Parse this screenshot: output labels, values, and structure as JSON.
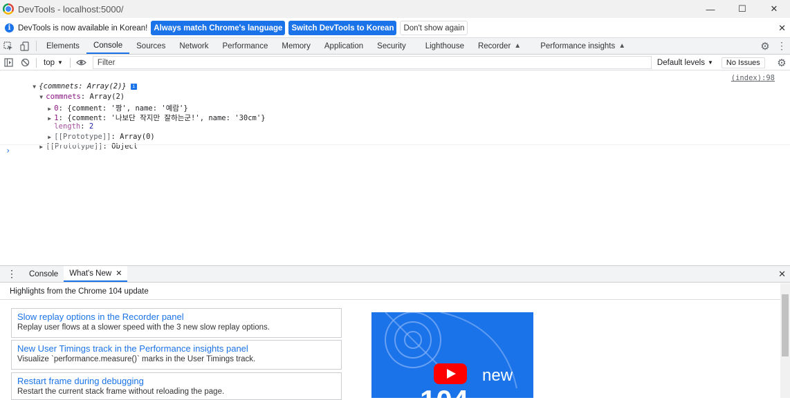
{
  "window": {
    "title": "DevTools - localhost:5000/"
  },
  "infobar": {
    "message": "DevTools is now available in Korean!",
    "btn_match": "Always match Chrome's language",
    "btn_switch": "Switch DevTools to Korean",
    "btn_dismiss": "Don't show again"
  },
  "tabs": [
    "Elements",
    "Console",
    "Sources",
    "Network",
    "Performance",
    "Memory",
    "Application",
    "Security",
    "Lighthouse",
    "Recorder",
    "Performance insights"
  ],
  "console_toolbar": {
    "context": "top",
    "filter_placeholder": "Filter",
    "levels": "Default levels",
    "issues": "No Issues"
  },
  "console": {
    "source_link": "(index):98",
    "line1": "{commnets: Array(2)}",
    "line2_key": "commnets",
    "line2_val": "Array(2)",
    "line3_key": "0",
    "line3_val": "{comment: '짱', name: '예람'}",
    "line4_key": "1",
    "line4_val": "{comment: '나보단 작지만 잘하는군!', name: '30cm'}",
    "line5_key": "length",
    "line5_val": "2",
    "line6_key": "[[Prototype]]",
    "line6_val": "Array(0)",
    "line7_key": "[[Prototype]]",
    "line7_val": "Object",
    "prompt": "›"
  },
  "drawer": {
    "tabs": [
      "Console",
      "What's New"
    ],
    "highlights": "Highlights from the Chrome 104 update",
    "cards": [
      {
        "title": "Slow replay options in the Recorder panel",
        "desc": "Replay user flows at a slower speed with the 3 new slow replay options."
      },
      {
        "title": "New User Timings track in the Performance insights panel",
        "desc": "Visualize `performance.measure()` marks in the User Timings track."
      },
      {
        "title": "Restart frame during debugging",
        "desc": "Restart the current stack frame without reloading the page."
      }
    ],
    "promo_text": "new",
    "promo_number": "104"
  }
}
